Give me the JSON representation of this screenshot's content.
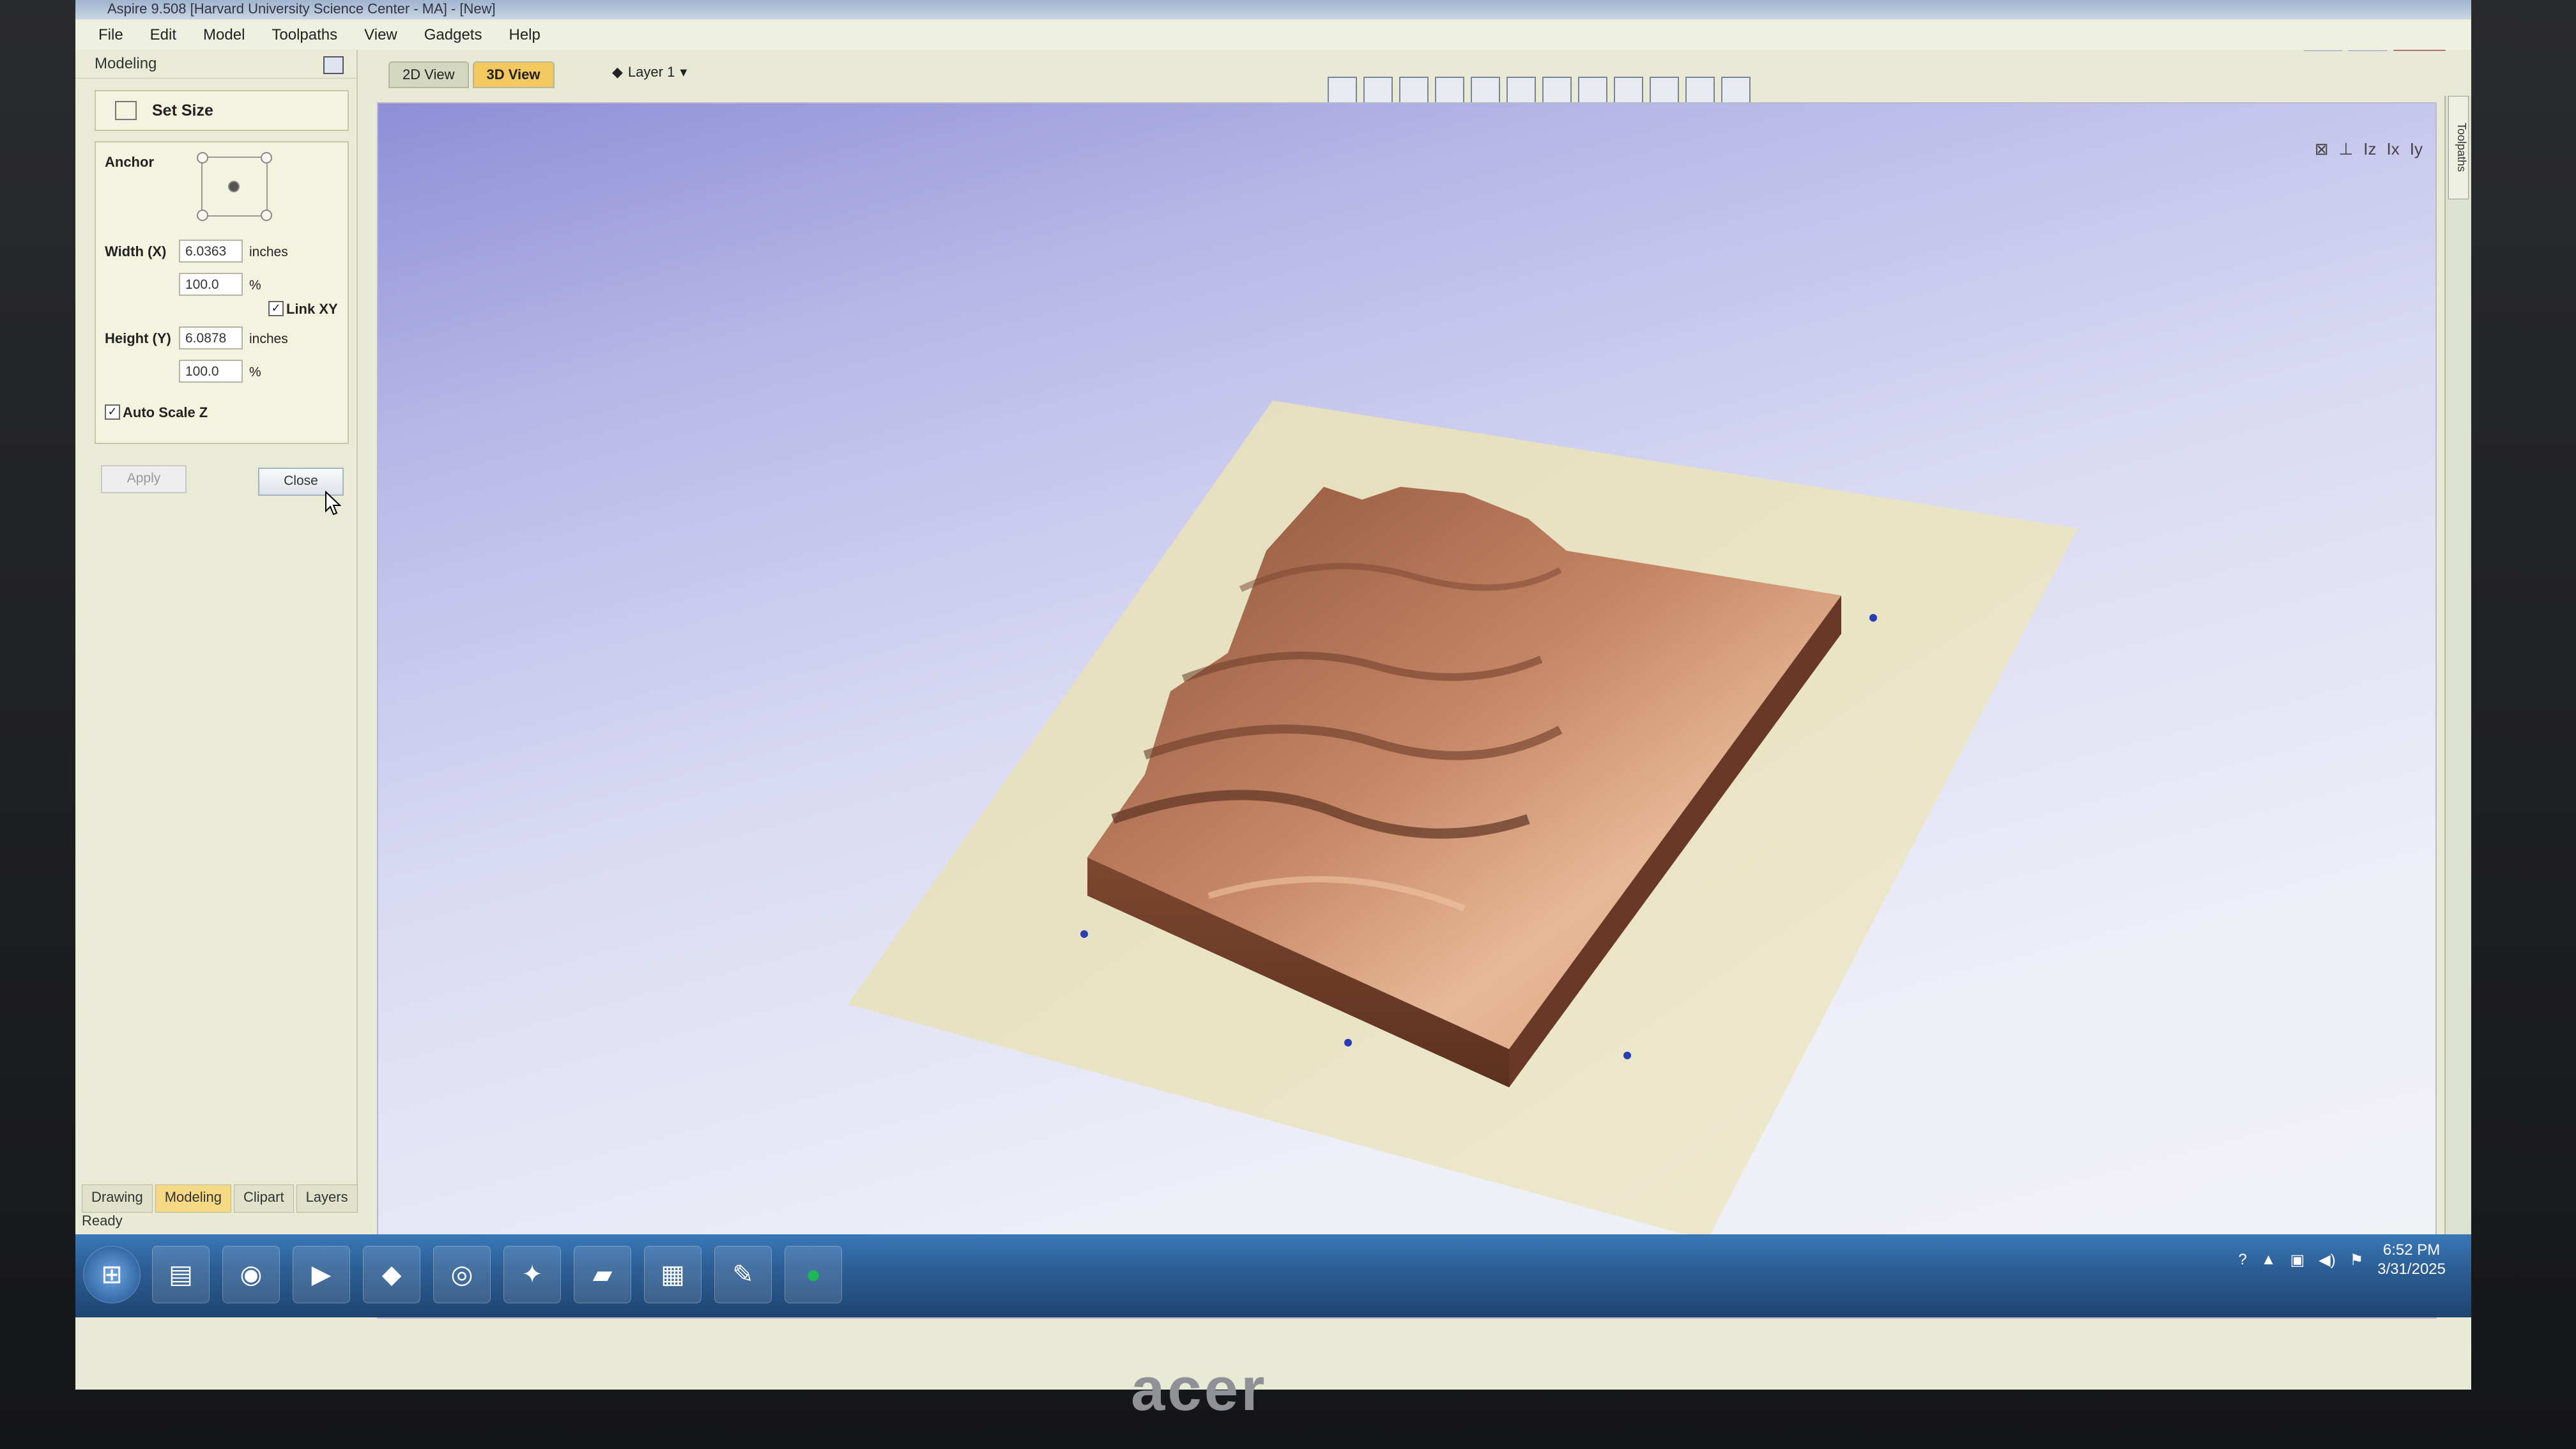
{
  "window": {
    "title": "Aspire 9.508 [Harvard University Science Center - MA] - [New]",
    "menu": [
      "File",
      "Edit",
      "Model",
      "Toolpaths",
      "View",
      "Gadgets",
      "Help"
    ]
  },
  "panel": {
    "title": "Modeling",
    "set_size_label": "Set Size",
    "anchor_label": "Anchor",
    "width_label": "Width (X)",
    "width_value": "6.0363",
    "width_unit": "inches",
    "width_percent": "100.0",
    "percent_symbol": "%",
    "link_xy_label": "Link XY",
    "height_label": "Height (Y)",
    "height_value": "6.0878",
    "height_unit": "inches",
    "height_percent": "100.0",
    "auto_scale_label": "Auto Scale Z",
    "apply_label": "Apply",
    "close_label": "Close",
    "bottom_tabs": [
      "Drawing",
      "Modeling",
      "Clipart",
      "Layers"
    ]
  },
  "status": "Ready",
  "view": {
    "tabs": [
      "2D View",
      "3D View"
    ],
    "active_tab": "3D View",
    "layer_label": "Layer 1",
    "right_tab": "Toolpaths",
    "view_icons": [
      "Iz",
      "Ix",
      "Iy"
    ]
  },
  "taskbar": {
    "time": "6:52 PM",
    "date": "3/31/2025"
  },
  "monitor": {
    "brand": "acer"
  },
  "colors": {
    "accent_tab": "#f3c85e",
    "terrain_light": "#e7b08d",
    "terrain_dark": "#7a4630",
    "base_plane": "#e9e4c4"
  }
}
